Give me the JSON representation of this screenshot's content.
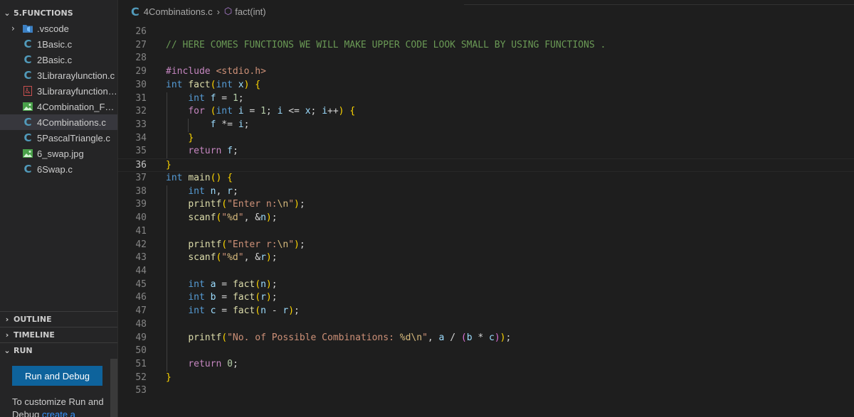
{
  "explorer": {
    "folder": "5.FUNCTIONS",
    "items": [
      {
        "label": ".vscode",
        "icon": "vscode-folder-icon",
        "kind": "folder"
      },
      {
        "label": "1Basic.c",
        "icon": "c-file-icon",
        "kind": "c"
      },
      {
        "label": "2Basic.c",
        "icon": "c-file-icon",
        "kind": "c"
      },
      {
        "label": "3Libraraylunction.c",
        "icon": "c-file-icon",
        "kind": "c"
      },
      {
        "label": "3Librarayfunction....",
        "icon": "pdf-file-icon",
        "kind": "pdf"
      },
      {
        "label": "4Combination_Fo...",
        "icon": "image-file-icon",
        "kind": "img"
      },
      {
        "label": "4Combinations.c",
        "icon": "c-file-icon",
        "kind": "c",
        "active": true
      },
      {
        "label": "5PascalTriangle.c",
        "icon": "c-file-icon",
        "kind": "c"
      },
      {
        "label": "6_swap.jpg",
        "icon": "image-file-icon",
        "kind": "img"
      },
      {
        "label": "6Swap.c",
        "icon": "c-file-icon",
        "kind": "c"
      }
    ]
  },
  "sections": {
    "outline": "OUTLINE",
    "timeline": "TIMELINE",
    "run": "RUN"
  },
  "run": {
    "button": "Run and Debug",
    "text": "To customize Run and Debug",
    "link": "create a"
  },
  "breadcrumb": {
    "file": "4Combinations.c",
    "symbol": "fact(int)"
  },
  "editor": {
    "current_line": 36,
    "lines": [
      {
        "n": "26",
        "t": ""
      },
      {
        "n": "27",
        "t": "// HERE COMES FUNCTIONS WE WILL MAKE UPPER CODE LOOK SMALL BY USING FUNCTIONS ."
      },
      {
        "n": "28",
        "t": ""
      },
      {
        "n": "29",
        "t": "#include <stdio.h>"
      },
      {
        "n": "30",
        "t": "int fact(int x) {"
      },
      {
        "n": "31",
        "t": "    int f = 1;"
      },
      {
        "n": "32",
        "t": "    for (int i = 1; i <= x; i++) {"
      },
      {
        "n": "33",
        "t": "        f *= i;"
      },
      {
        "n": "34",
        "t": "    }"
      },
      {
        "n": "35",
        "t": "    return f;"
      },
      {
        "n": "36",
        "t": "}"
      },
      {
        "n": "37",
        "t": "int main() {"
      },
      {
        "n": "38",
        "t": "    int n, r;"
      },
      {
        "n": "39",
        "t": "    printf(\"Enter n:\\n\");"
      },
      {
        "n": "40",
        "t": "    scanf(\"%d\", &n);"
      },
      {
        "n": "41",
        "t": ""
      },
      {
        "n": "42",
        "t": "    printf(\"Enter r:\\n\");"
      },
      {
        "n": "43",
        "t": "    scanf(\"%d\", &r);"
      },
      {
        "n": "44",
        "t": ""
      },
      {
        "n": "45",
        "t": "    int a = fact(n);"
      },
      {
        "n": "46",
        "t": "    int b = fact(r);"
      },
      {
        "n": "47",
        "t": "    int c = fact(n - r);"
      },
      {
        "n": "48",
        "t": ""
      },
      {
        "n": "49",
        "t": "    printf(\"No. of Possible Combinations: %d\\n\", a / (b * c));"
      },
      {
        "n": "50",
        "t": ""
      },
      {
        "n": "51",
        "t": "    return 0;"
      },
      {
        "n": "52",
        "t": "}"
      },
      {
        "n": "53",
        "t": ""
      }
    ]
  },
  "colors": {
    "background": "#1e1e1e",
    "sidebar": "#252526",
    "accent_button": "#0e639c",
    "c_icon": "#519aba"
  }
}
